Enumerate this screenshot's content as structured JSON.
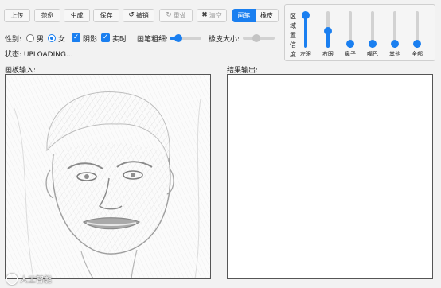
{
  "toolbar": {
    "upload": "上传",
    "example": "范例",
    "generate": "生成",
    "save": "保存",
    "undo": "撤销",
    "redo": "重做",
    "clear": "清空"
  },
  "mode": {
    "pen": "画笔",
    "eraser": "橡皮"
  },
  "options": {
    "gender_label": "性别:",
    "male": "男",
    "female": "女",
    "gender_selected": "女",
    "shadow": "阴影",
    "realtime": "实时",
    "pen_width_label": "画笔粗细:",
    "pen_width_value": 0.2,
    "eraser_size_label": "橡皮大小:",
    "eraser_size_value": 0.4
  },
  "status": "状态: UPLOADING...",
  "confidence": {
    "title": "区域置信度",
    "sliders": [
      {
        "label": "左眼",
        "value": 1.0
      },
      {
        "label": "右眼",
        "value": 0.45
      },
      {
        "label": "鼻子",
        "value": 0.0
      },
      {
        "label": "嘴巴",
        "value": 0.0
      },
      {
        "label": "其他",
        "value": 0.0
      },
      {
        "label": "全部",
        "value": 0.0
      }
    ]
  },
  "input_label": "画板输入:",
  "output_label": "结果输出:",
  "watermark": "人工智能",
  "colors": {
    "accent": "#1a7ff0",
    "background": "#f2f2f2"
  }
}
